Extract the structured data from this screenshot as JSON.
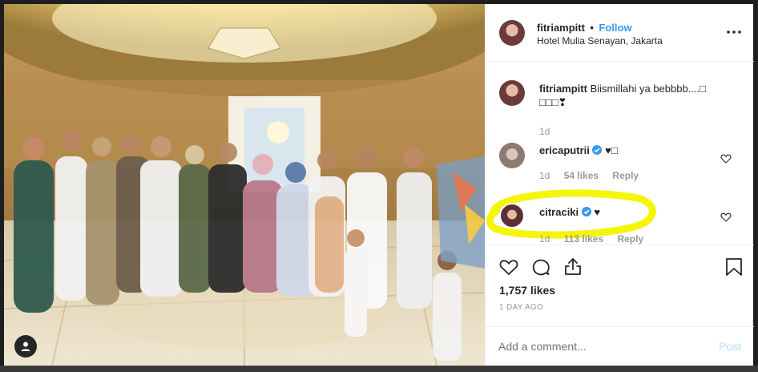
{
  "post": {
    "username": "fitriampitt",
    "separator": "•",
    "follow_label": "Follow",
    "location": "Hotel Mulia Senayan, Jakarta",
    "more_label": "•••"
  },
  "caption": {
    "username": "fitriampitt",
    "text": "Biismillahi ya bebbbb....□",
    "text_line2": "□□□❣",
    "age": "1d"
  },
  "comments": [
    {
      "username": "ericaputrii",
      "verified": true,
      "text": "♥□",
      "age": "1d",
      "likes": "54 likes",
      "reply": "Reply"
    },
    {
      "username": "citraciki",
      "verified": true,
      "text": "♥",
      "age": "1d",
      "likes": "113 likes",
      "reply": "Reply"
    }
  ],
  "stats": {
    "likes": "1,757 likes",
    "date": "1 DAY AGO"
  },
  "add_comment": {
    "placeholder": "Add a comment...",
    "post_label": "Post"
  },
  "colors": {
    "accent": "#3897f0",
    "highlight": "#f5f50a",
    "muted": "#999999",
    "text": "#262626"
  },
  "icons": [
    "more-icon",
    "verified-icon",
    "heart-icon",
    "comment-icon",
    "share-icon",
    "bookmark-icon",
    "user-tag-icon"
  ]
}
